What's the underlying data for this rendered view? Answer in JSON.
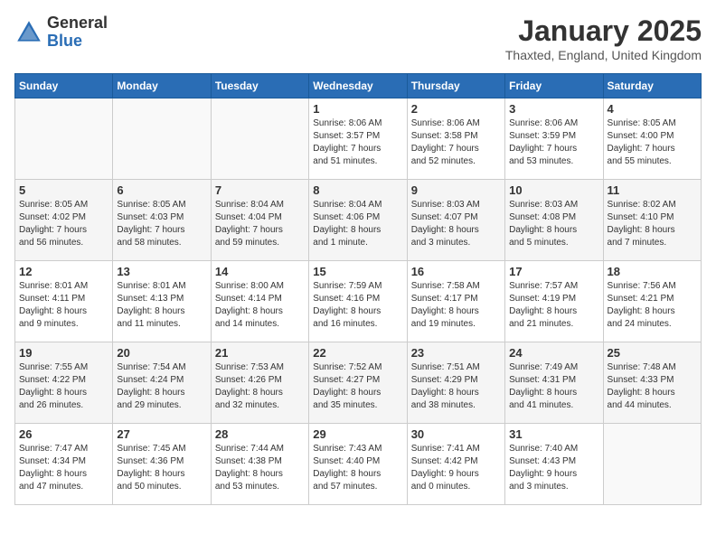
{
  "logo": {
    "general": "General",
    "blue": "Blue"
  },
  "title": "January 2025",
  "location": "Thaxted, England, United Kingdom",
  "weekdays": [
    "Sunday",
    "Monday",
    "Tuesday",
    "Wednesday",
    "Thursday",
    "Friday",
    "Saturday"
  ],
  "weeks": [
    [
      {
        "day": "",
        "info": ""
      },
      {
        "day": "",
        "info": ""
      },
      {
        "day": "",
        "info": ""
      },
      {
        "day": "1",
        "info": "Sunrise: 8:06 AM\nSunset: 3:57 PM\nDaylight: 7 hours\nand 51 minutes."
      },
      {
        "day": "2",
        "info": "Sunrise: 8:06 AM\nSunset: 3:58 PM\nDaylight: 7 hours\nand 52 minutes."
      },
      {
        "day": "3",
        "info": "Sunrise: 8:06 AM\nSunset: 3:59 PM\nDaylight: 7 hours\nand 53 minutes."
      },
      {
        "day": "4",
        "info": "Sunrise: 8:05 AM\nSunset: 4:00 PM\nDaylight: 7 hours\nand 55 minutes."
      }
    ],
    [
      {
        "day": "5",
        "info": "Sunrise: 8:05 AM\nSunset: 4:02 PM\nDaylight: 7 hours\nand 56 minutes."
      },
      {
        "day": "6",
        "info": "Sunrise: 8:05 AM\nSunset: 4:03 PM\nDaylight: 7 hours\nand 58 minutes."
      },
      {
        "day": "7",
        "info": "Sunrise: 8:04 AM\nSunset: 4:04 PM\nDaylight: 7 hours\nand 59 minutes."
      },
      {
        "day": "8",
        "info": "Sunrise: 8:04 AM\nSunset: 4:06 PM\nDaylight: 8 hours\nand 1 minute."
      },
      {
        "day": "9",
        "info": "Sunrise: 8:03 AM\nSunset: 4:07 PM\nDaylight: 8 hours\nand 3 minutes."
      },
      {
        "day": "10",
        "info": "Sunrise: 8:03 AM\nSunset: 4:08 PM\nDaylight: 8 hours\nand 5 minutes."
      },
      {
        "day": "11",
        "info": "Sunrise: 8:02 AM\nSunset: 4:10 PM\nDaylight: 8 hours\nand 7 minutes."
      }
    ],
    [
      {
        "day": "12",
        "info": "Sunrise: 8:01 AM\nSunset: 4:11 PM\nDaylight: 8 hours\nand 9 minutes."
      },
      {
        "day": "13",
        "info": "Sunrise: 8:01 AM\nSunset: 4:13 PM\nDaylight: 8 hours\nand 11 minutes."
      },
      {
        "day": "14",
        "info": "Sunrise: 8:00 AM\nSunset: 4:14 PM\nDaylight: 8 hours\nand 14 minutes."
      },
      {
        "day": "15",
        "info": "Sunrise: 7:59 AM\nSunset: 4:16 PM\nDaylight: 8 hours\nand 16 minutes."
      },
      {
        "day": "16",
        "info": "Sunrise: 7:58 AM\nSunset: 4:17 PM\nDaylight: 8 hours\nand 19 minutes."
      },
      {
        "day": "17",
        "info": "Sunrise: 7:57 AM\nSunset: 4:19 PM\nDaylight: 8 hours\nand 21 minutes."
      },
      {
        "day": "18",
        "info": "Sunrise: 7:56 AM\nSunset: 4:21 PM\nDaylight: 8 hours\nand 24 minutes."
      }
    ],
    [
      {
        "day": "19",
        "info": "Sunrise: 7:55 AM\nSunset: 4:22 PM\nDaylight: 8 hours\nand 26 minutes."
      },
      {
        "day": "20",
        "info": "Sunrise: 7:54 AM\nSunset: 4:24 PM\nDaylight: 8 hours\nand 29 minutes."
      },
      {
        "day": "21",
        "info": "Sunrise: 7:53 AM\nSunset: 4:26 PM\nDaylight: 8 hours\nand 32 minutes."
      },
      {
        "day": "22",
        "info": "Sunrise: 7:52 AM\nSunset: 4:27 PM\nDaylight: 8 hours\nand 35 minutes."
      },
      {
        "day": "23",
        "info": "Sunrise: 7:51 AM\nSunset: 4:29 PM\nDaylight: 8 hours\nand 38 minutes."
      },
      {
        "day": "24",
        "info": "Sunrise: 7:49 AM\nSunset: 4:31 PM\nDaylight: 8 hours\nand 41 minutes."
      },
      {
        "day": "25",
        "info": "Sunrise: 7:48 AM\nSunset: 4:33 PM\nDaylight: 8 hours\nand 44 minutes."
      }
    ],
    [
      {
        "day": "26",
        "info": "Sunrise: 7:47 AM\nSunset: 4:34 PM\nDaylight: 8 hours\nand 47 minutes."
      },
      {
        "day": "27",
        "info": "Sunrise: 7:45 AM\nSunset: 4:36 PM\nDaylight: 8 hours\nand 50 minutes."
      },
      {
        "day": "28",
        "info": "Sunrise: 7:44 AM\nSunset: 4:38 PM\nDaylight: 8 hours\nand 53 minutes."
      },
      {
        "day": "29",
        "info": "Sunrise: 7:43 AM\nSunset: 4:40 PM\nDaylight: 8 hours\nand 57 minutes."
      },
      {
        "day": "30",
        "info": "Sunrise: 7:41 AM\nSunset: 4:42 PM\nDaylight: 9 hours\nand 0 minutes."
      },
      {
        "day": "31",
        "info": "Sunrise: 7:40 AM\nSunset: 4:43 PM\nDaylight: 9 hours\nand 3 minutes."
      },
      {
        "day": "",
        "info": ""
      }
    ]
  ]
}
